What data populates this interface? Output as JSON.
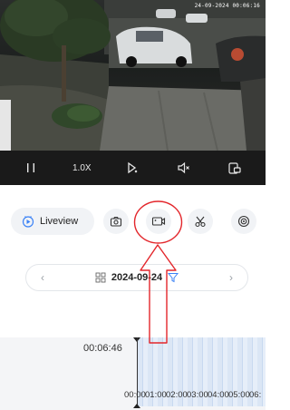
{
  "video": {
    "timestamp": "24-09-2024 00:06:16"
  },
  "controls": {
    "speed_label": "1.0X"
  },
  "actions": {
    "liveview_label": "Liveview"
  },
  "date_bar": {
    "date": "2024-09-24",
    "prev": "‹",
    "next": "›"
  },
  "timeline": {
    "current_time": "00:06:46",
    "tick_labels": [
      "00:00",
      "01:00",
      "02:00",
      "03:00",
      "04:00",
      "05:00",
      "06:"
    ]
  },
  "colors": {
    "accent": "#3b82f6",
    "annotation": "#e3262b"
  }
}
